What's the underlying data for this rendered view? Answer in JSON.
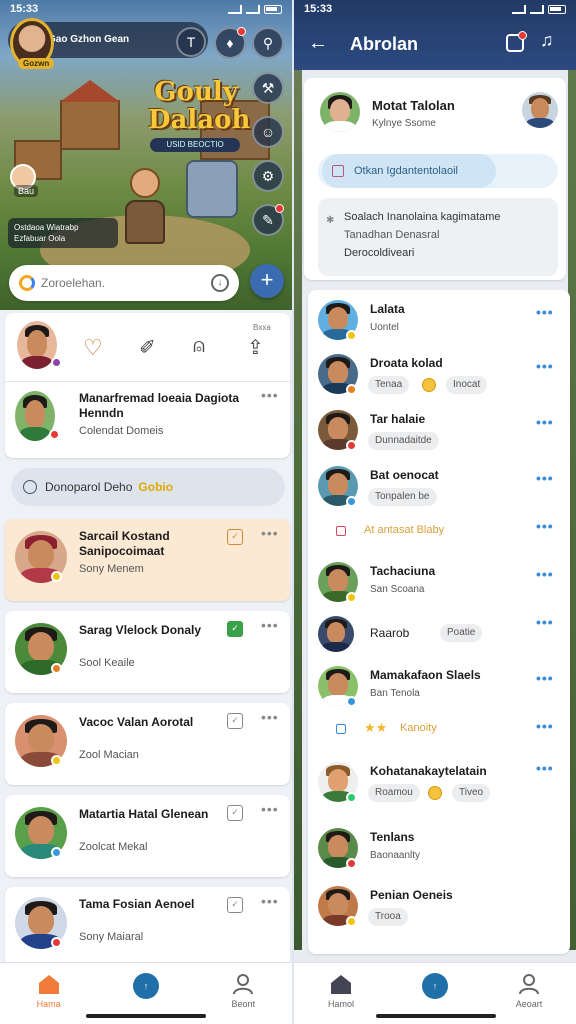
{
  "status": {
    "time_left": "15:33",
    "time_right": "15:33"
  },
  "left": {
    "profile": {
      "name": "Gao Gzhon Gean",
      "badge": "Gozwn"
    },
    "game": {
      "title": "Gouly Dalaoh",
      "subtitle": "USID BEOCTIO"
    },
    "mini_player": {
      "label": "Bau"
    },
    "quest": {
      "line1": "Ostdaoa Wiatrabp",
      "line2": "Ezfabuar  Oola"
    },
    "search": {
      "placeholder": "Zoroelehan."
    },
    "actions_card": {
      "tag": "Bxxa"
    },
    "contacts": [
      {
        "name": "Manarfremad loeaia Dagiota Henndn",
        "sub": "Colendat Domeis"
      },
      {
        "name": "Sarcail Kostand Sanipocoimaat",
        "sub": "Sony Menem"
      },
      {
        "name": "Sarag Vlelock Donaly",
        "sub": "Sool Keaile"
      },
      {
        "name": "Vacoc Valan Aorotal",
        "sub": "Zool Macian"
      },
      {
        "name": "Matartia Hatal Glenean",
        "sub": "Zoolcat Mekal"
      },
      {
        "name": "Tama Fosian Aenoel",
        "sub": "Sony Maiaral"
      }
    ],
    "divider": {
      "text": "Donoparol Deho",
      "highlight": "Gobio"
    },
    "nav": [
      {
        "label": "Hama"
      },
      {
        "label": ""
      },
      {
        "label": "Beont"
      }
    ],
    "colors": {
      "accent": "#3b6bb0",
      "highlight_card": "#fbe9d3"
    }
  },
  "right": {
    "title": "Abrolan",
    "header_contact": {
      "name": "Motat Talolan",
      "sub": "Kylnye Ssome"
    },
    "message": {
      "line": "Otkan Igdantentolaoil"
    },
    "note": {
      "line1": "Soalach Inanolaina kagimatame",
      "line2": "Tanadhan Denasral",
      "line3": "Derocoldiveari"
    },
    "list": [
      {
        "name": "Lalata",
        "sub": "Uontel"
      },
      {
        "name": "Droata kolad",
        "sub": "Tenaa",
        "chip": "Inocat"
      },
      {
        "name": "Tar halaie",
        "sub": "Dunnadaitde"
      },
      {
        "name": "Bat oenocat",
        "sub": "Tonpalen be"
      },
      {
        "name": "Tachaciuna",
        "sub": "San Scoana"
      },
      {
        "name": "Raarob",
        "sub": "",
        "chip": "Poatie"
      },
      {
        "name": "Mamakafaon Slaels",
        "sub": "Ban Tenola"
      },
      {
        "name": "Kohatanakaytelatain",
        "sub": "Roamou",
        "chip": "Tiveo"
      },
      {
        "name": "Tenlans",
        "sub": "Baonaanlty"
      },
      {
        "name": "Penian Oeneis",
        "sub": "Trooa"
      }
    ],
    "banner1": {
      "text": "At antasat Blaby"
    },
    "banner2": {
      "text": "Kanoity"
    },
    "nav": [
      {
        "label": "Hamol"
      },
      {
        "label": ""
      },
      {
        "label": "Aeoart"
      }
    ]
  }
}
